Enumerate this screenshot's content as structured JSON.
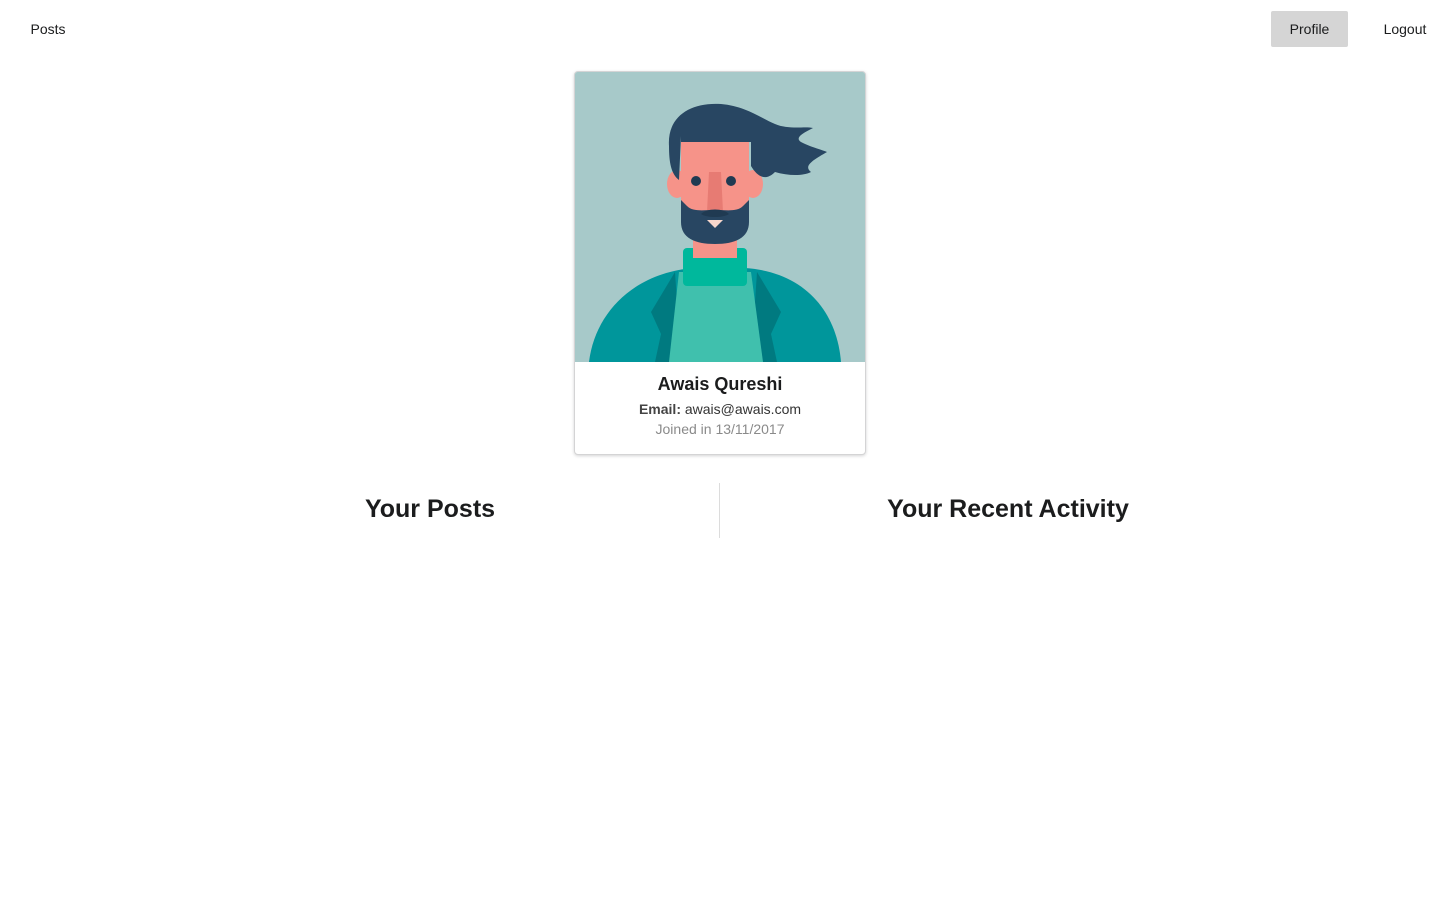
{
  "nav": {
    "posts_label": "Posts",
    "profile_label": "Profile",
    "logout_label": "Logout"
  },
  "profile_card": {
    "name": "Awais Qureshi",
    "email_label": "Email:",
    "email": "awais@awais.com",
    "joined": "Joined in 13/11/2017",
    "avatar_icon": "bearded-man-avatar-icon"
  },
  "sections": {
    "posts_title": "Your Posts",
    "activity_title": "Your Recent Activity"
  },
  "colors": {
    "avatar_background": "#a7c9c9",
    "active_nav_background": "#d5d5d5"
  }
}
